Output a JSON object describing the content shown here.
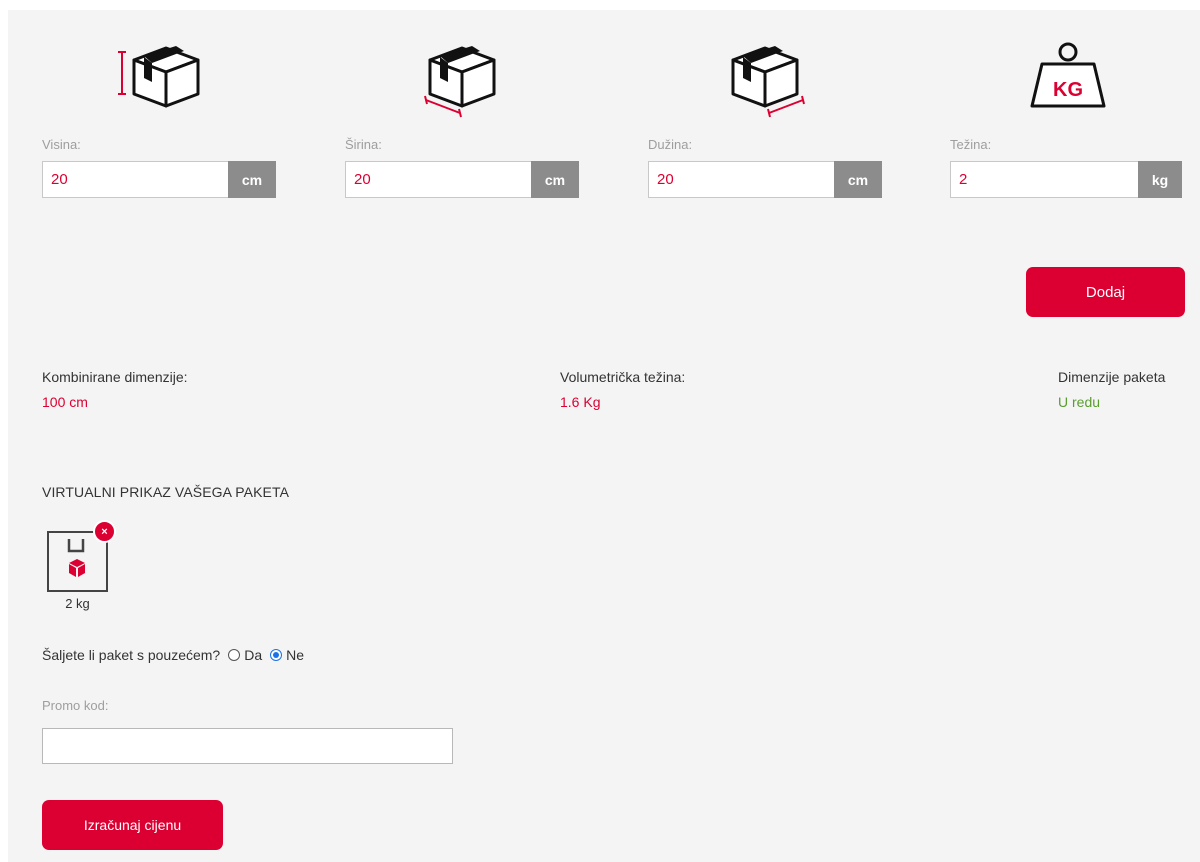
{
  "dimensions": [
    {
      "key": "height",
      "label": "Visina:",
      "value": "20",
      "unit": "cm",
      "icon": "box-height-icon"
    },
    {
      "key": "width",
      "label": "Širina:",
      "value": "20",
      "unit": "cm",
      "icon": "box-width-icon"
    },
    {
      "key": "length",
      "label": "Dužina:",
      "value": "20",
      "unit": "cm",
      "icon": "box-length-icon"
    },
    {
      "key": "weight",
      "label": "Težina:",
      "value": "2",
      "unit": "kg",
      "icon": "kg-weight-icon",
      "icon_text": "KG"
    }
  ],
  "add_button": "Dodaj",
  "stats": {
    "combined_label": "Kombinirane dimenzije:",
    "combined_value": "100 cm",
    "volumetric_label": "Volumetrička težina:",
    "volumetric_value": "1.6 Kg",
    "status_label": "Dimenzije paketa",
    "status_value": "U redu"
  },
  "virtual_preview": {
    "title": "VIRTUALNI PRIKAZ VAŠEGA PAKETA",
    "packages": [
      {
        "weight": "2 kg",
        "remove": "×"
      }
    ]
  },
  "cod": {
    "question": "Šaljete li paket s pouzećem?",
    "options": [
      {
        "label": "Da",
        "checked": false
      },
      {
        "label": "Ne",
        "checked": true
      }
    ]
  },
  "promo": {
    "label": "Promo kod:",
    "value": ""
  },
  "calculate_button": "Izračunaj cijenu",
  "colors": {
    "accent": "#dc0032",
    "ok": "#5a9e2f",
    "unit_bg": "#8c8c8c",
    "panel_bg": "#f4f4f4"
  }
}
